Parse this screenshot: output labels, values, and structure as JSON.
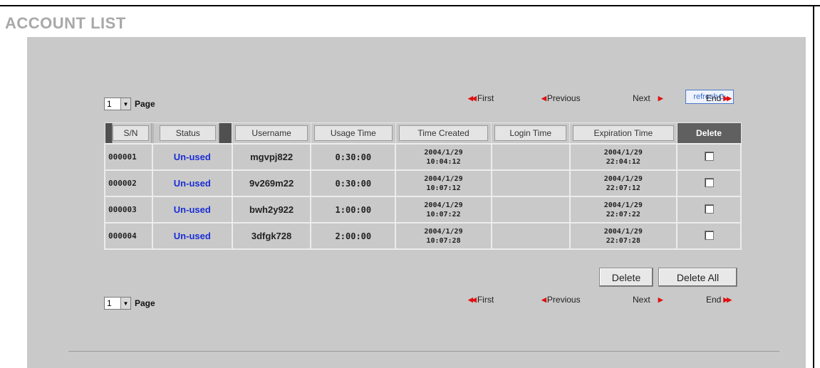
{
  "page_title": "ACCOUNT LIST",
  "refresh_label": "refresh",
  "page_selector": {
    "value": "1",
    "label": "Page"
  },
  "pager": {
    "first": "First",
    "previous": "Previous",
    "next": "Next",
    "end": "End"
  },
  "table": {
    "columns": [
      "S/N",
      "Status",
      "Username",
      "Usage Time",
      "Time Created",
      "Login Time",
      "Expiration Time",
      "Delete"
    ],
    "rows": [
      {
        "sn": "000001",
        "status": "Un-used",
        "username": "mgvpj822",
        "usage_time": "0:30:00",
        "created_date": "2004/1/29",
        "created_time": "10:04:12",
        "login_time": "",
        "exp_date": "2004/1/29",
        "exp_time": "22:04:12"
      },
      {
        "sn": "000002",
        "status": "Un-used",
        "username": "9v269m22",
        "usage_time": "0:30:00",
        "created_date": "2004/1/29",
        "created_time": "10:07:12",
        "login_time": "",
        "exp_date": "2004/1/29",
        "exp_time": "22:07:12"
      },
      {
        "sn": "000003",
        "status": "Un-used",
        "username": "bwh2y922",
        "usage_time": "1:00:00",
        "created_date": "2004/1/29",
        "created_time": "10:07:22",
        "login_time": "",
        "exp_date": "2004/1/29",
        "exp_time": "22:07:22"
      },
      {
        "sn": "000004",
        "status": "Un-used",
        "username": "3dfgk728",
        "usage_time": "2:00:00",
        "created_date": "2004/1/29",
        "created_time": "10:07:28",
        "login_time": "",
        "exp_date": "2004/1/29",
        "exp_time": "22:07:28"
      }
    ]
  },
  "buttons": {
    "delete": "Delete",
    "delete_all": "Delete All"
  },
  "colors": {
    "panel": "#c9c9c9",
    "status_link": "#1a2dd6",
    "nav_icon": "#e01010",
    "title": "#a8a8a8"
  }
}
